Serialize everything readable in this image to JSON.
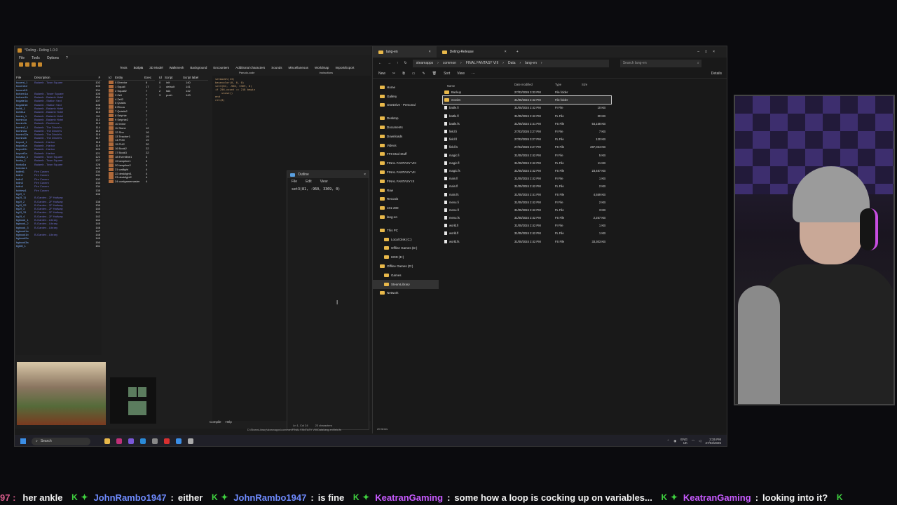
{
  "deling": {
    "title": "*Deling - Deling 1.0.0",
    "menu": [
      "File",
      "Tools",
      "Options",
      "?"
    ],
    "tabs": [
      "Texts",
      "Scripts",
      "3D Model",
      "Walkmesh",
      "Background",
      "Encounters",
      "Additional characters",
      "Sounds",
      "Miscellaneous",
      "Worldmap",
      "Import/Export"
    ],
    "field_list_headers": [
      "File",
      "Description",
      "#"
    ],
    "fields": [
      {
        "name": "bccent_1",
        "desc": "Balamb - Town Square",
        "id": "102"
      },
      {
        "name": "bccent12",
        "desc": "",
        "id": "103"
      },
      {
        "name": "bccent15",
        "desc": "",
        "id": "104"
      },
      {
        "name": "bcform1a",
        "desc": "Balamb - Tower Square",
        "id": "105"
      },
      {
        "name": "bcform1b",
        "desc": "Balamb - Balamb Hotel",
        "id": "106"
      },
      {
        "name": "bcgate1a",
        "desc": "Balamb - Station Yard",
        "id": "107"
      },
      {
        "name": "bcgate1b",
        "desc": "Balamb - Station Yard",
        "id": "108"
      },
      {
        "name": "bchtl_1",
        "desc": "Balamb - Balamb Hotel",
        "id": "109"
      },
      {
        "name": "bchtl1a",
        "desc": "Balamb - Balamb Hotel",
        "id": "110"
      },
      {
        "name": "bcmin_1",
        "desc": "Balamb - Balamb Hotel",
        "id": "111"
      },
      {
        "name": "bcmin1a",
        "desc": "Balamb - Balamb Hotel",
        "id": "112"
      },
      {
        "name": "bcmin1b",
        "desc": "Balamb - Residence",
        "id": "113"
      },
      {
        "name": "bcmin2_1",
        "desc": "Balamb - The Dincht's",
        "id": "114"
      },
      {
        "name": "bcmin2a",
        "desc": "Balamb - The Dincht's",
        "id": "115"
      },
      {
        "name": "bcmin22a",
        "desc": "Balamb - The Dincht's",
        "id": "116"
      },
      {
        "name": "bcmin2b",
        "desc": "Balamb - The Dincht's",
        "id": "117"
      },
      {
        "name": "bcport_1",
        "desc": "Balamb - Harbor",
        "id": "118"
      },
      {
        "name": "bcport1a",
        "desc": "Balamb - Harbor",
        "id": "119"
      },
      {
        "name": "bcport1b",
        "desc": "Balamb - Harbor",
        "id": "120"
      },
      {
        "name": "bcport2a",
        "desc": "Balamb - Harbor",
        "id": "121"
      },
      {
        "name": "bcsaka_1",
        "desc": "Balamb - Town Square",
        "id": "122"
      },
      {
        "name": "bcsta_1",
        "desc": "Balamb - Town Square",
        "id": "127"
      },
      {
        "name": "bcsta1a",
        "desc": "Balamb - Town Square",
        "id": "128"
      },
      {
        "name": "bdenter1",
        "desc": "",
        "id": "129"
      },
      {
        "name": "bdifrit1",
        "desc": "Fire Cavern",
        "id": "130"
      },
      {
        "name": "bdin1",
        "desc": "Fire Cavern",
        "id": "131"
      },
      {
        "name": "bdin2",
        "desc": "Fire Cavern",
        "id": "132"
      },
      {
        "name": "bdin3",
        "desc": "Fire Cavern",
        "id": "133"
      },
      {
        "name": "bdin4",
        "desc": "Fire Cavern",
        "id": "134"
      },
      {
        "name": "bdview1",
        "desc": "Fire Cavern",
        "id": "135"
      },
      {
        "name": "bg2f_1",
        "desc": "",
        "id": "136"
      },
      {
        "name": "bg2f_11",
        "desc": "B-Garden - 2F Hallway",
        "id": "-"
      },
      {
        "name": "bg2f_2",
        "desc": "B-Garden - 2F Hallway",
        "id": "138"
      },
      {
        "name": "bg2f_22",
        "desc": "B-Garden - 2F Hallway",
        "id": "139"
      },
      {
        "name": "bg2f_3",
        "desc": "B-Garden - 2F Hallway",
        "id": "140"
      },
      {
        "name": "bg2f_31",
        "desc": "B-Garden - 2F Hallway",
        "id": "141"
      },
      {
        "name": "bg2f_4",
        "desc": "B-Garden - 2F Hallway",
        "id": "142"
      },
      {
        "name": "bgbook_1",
        "desc": "B-Garden - Library",
        "id": "144"
      },
      {
        "name": "bgbook_2",
        "desc": "B-Garden - Library",
        "id": "145"
      },
      {
        "name": "bgbook_3",
        "desc": "B-Garden - Library",
        "id": "146"
      },
      {
        "name": "bgbook1a",
        "desc": "",
        "id": "147"
      },
      {
        "name": "bgbook1b",
        "desc": "B-Garden - Library",
        "id": "148"
      },
      {
        "name": "bgbook2a",
        "desc": "",
        "id": "149"
      },
      {
        "name": "bgbook3a",
        "desc": "",
        "id": "150"
      },
      {
        "name": "bgbill_1",
        "desc": "",
        "id": "151"
      }
    ],
    "entity_headers": [
      "Id",
      "Entity",
      "Exec"
    ],
    "entities": [
      {
        "n": "0 Director",
        "c": "6"
      },
      {
        "n": "1 Squall",
        "c": "17"
      },
      {
        "n": "2 Squall2",
        "c": "7"
      },
      {
        "n": "3 Zell",
        "c": "7"
      },
      {
        "n": "4 Zell2",
        "c": "7"
      },
      {
        "n": "5 Quistis",
        "c": "7"
      },
      {
        "n": "6 Rinoa",
        "c": "7"
      },
      {
        "n": "7 Quistis2",
        "c": "7"
      },
      {
        "n": "8 Selphie",
        "c": "7"
      },
      {
        "n": "9 Selphie2",
        "c": "7"
      },
      {
        "n": "10 Irvine",
        "c": "7"
      },
      {
        "n": "11 Stone",
        "c": "12"
      },
      {
        "n": "12 Shu",
        "c": "16"
      },
      {
        "n": "13 Teacher1",
        "c": "19"
      },
      {
        "n": "14 Pt30",
        "c": "19"
      },
      {
        "n": "15 Pt42",
        "c": "20"
      },
      {
        "n": "16 Book2",
        "c": "22"
      },
      {
        "n": "17 Book3",
        "c": "22"
      },
      {
        "n": "18 Eventline1",
        "c": "3"
      },
      {
        "n": "19 lampline1",
        "c": "3"
      },
      {
        "n": "20 lampline2",
        "c": "3"
      },
      {
        "n": "21 wallight",
        "c": "4"
      },
      {
        "n": "22 deskIight1",
        "c": "4"
      },
      {
        "n": "23 deskIight2",
        "c": "4"
      },
      {
        "n": "24 cardgamemaster",
        "c": "4"
      }
    ],
    "script_headers": [
      "Id",
      "Script",
      "Script label"
    ],
    "scripts": [
      {
        "id": "0",
        "name": "init",
        "label": "140"
      },
      {
        "id": "1",
        "name": "default",
        "label": "141"
      },
      {
        "id": "2",
        "name": "talk",
        "label": "142"
      },
      {
        "id": "3",
        "name": "push",
        "label": "143"
      }
    ],
    "code_headers": [
      "Pseudo-code",
      "Instructions"
    ],
    "code_lines": [
      "setmodel(13)",
      "basecolor(0, 0, 0)",
      "set3(81, -960, 3369, 0)",
      "if 256_count == 218 begin",
      "    unuse()",
      "end",
      "ret(8)"
    ],
    "compile_label": "Compile",
    "help_label": "Help",
    "path_status": "D:\\SteamLibrary\\steamapps\\common\\FINAL FANTASY VIII\\Data\\lang-en\\field.fs"
  },
  "notepad": {
    "title": "Outline",
    "menu": [
      "File",
      "Edit",
      "View"
    ],
    "content": "set3(81, -960, 3369, 0)",
    "status_pos": "Ln 1, Col 24",
    "status_chars": "23 characters"
  },
  "explorer": {
    "tabs": [
      "lang-en",
      "Deling-Release"
    ],
    "breadcrumbs": [
      "steamapps",
      "common",
      "FINAL FANTASY VIII",
      "Data",
      "lang-en"
    ],
    "search_placeholder": "Search lang-en",
    "commands": [
      "New",
      "Sort",
      "View",
      "Details"
    ],
    "nav_items": [
      {
        "label": "Home",
        "type": "top"
      },
      {
        "label": "Gallery",
        "type": "top"
      },
      {
        "label": "OneDrive - Personal",
        "type": "top"
      },
      {
        "label": "",
        "type": "gap"
      },
      {
        "label": "Desktop",
        "type": "pin"
      },
      {
        "label": "Documents",
        "type": "pin"
      },
      {
        "label": "Downloads",
        "type": "pin"
      },
      {
        "label": "Videos",
        "type": "pin"
      },
      {
        "label": "FF8 Mod Stuff",
        "type": "pin"
      },
      {
        "label": "FINAL FANTASY VIII",
        "type": "pin"
      },
      {
        "label": "FINAL FANTASY VII",
        "type": "pin"
      },
      {
        "label": "FINAL FANTASY IX",
        "type": "pin"
      },
      {
        "label": "Raw",
        "type": "pin"
      },
      {
        "label": "Recoois",
        "type": "pin"
      },
      {
        "label": "101-200",
        "type": "pin"
      },
      {
        "label": "lang-en",
        "type": "pin"
      },
      {
        "label": "",
        "type": "gap"
      },
      {
        "label": "This PC",
        "type": "top"
      },
      {
        "label": "Local Disk (C:)",
        "type": "sub"
      },
      {
        "label": "Offline Games (D:)",
        "type": "sub"
      },
      {
        "label": "HDD (E:)",
        "type": "sub"
      },
      {
        "label": "Offline Games (D:)",
        "type": "top"
      },
      {
        "label": "Games",
        "type": "sub"
      },
      {
        "label": "SteamLibrary",
        "type": "sel"
      },
      {
        "label": "Network",
        "type": "top"
      }
    ],
    "file_headers": [
      "Name",
      "Date modified",
      "Type",
      "Size"
    ],
    "files": [
      {
        "name": "Backup",
        "date": "27/03/2026 3:33 PM",
        "type": "File folder",
        "size": "",
        "folder": true
      },
      {
        "name": "movies",
        "date": "31/05/2024 2:42 PM",
        "type": "File folder",
        "size": "",
        "folder": true,
        "sel": true
      },
      {
        "name": "battle.fi",
        "date": "31/05/2024 2:42 PM",
        "type": "FI File",
        "size": "10 KB"
      },
      {
        "name": "battle.fl",
        "date": "31/05/2024 2:42 PM",
        "type": "FL File",
        "size": "30 KB"
      },
      {
        "name": "battle.fs",
        "date": "31/05/2024 2:41 PM",
        "type": "FS File",
        "size": "54,158 KB"
      },
      {
        "name": "field.fi",
        "date": "27/03/2026 3:27 PM",
        "type": "FI File",
        "size": "7 KB"
      },
      {
        "name": "field.fl",
        "date": "27/03/2026 3:27 PM",
        "type": "FL File",
        "size": "120 KB"
      },
      {
        "name": "field.fs",
        "date": "27/03/2026 3:27 PM",
        "type": "FS File",
        "size": "287,034 KB"
      },
      {
        "name": "magic.fi",
        "date": "31/05/2024 2:42 PM",
        "type": "FI File",
        "size": "5 KB"
      },
      {
        "name": "magic.fl",
        "date": "31/05/2024 2:42 PM",
        "type": "FL File",
        "size": "11 KB"
      },
      {
        "name": "magic.fs",
        "date": "31/05/2024 2:42 PM",
        "type": "FS File",
        "size": "23,487 KB"
      },
      {
        "name": "main.fi",
        "date": "31/05/2024 2:42 PM",
        "type": "FI File",
        "size": "1 KB"
      },
      {
        "name": "main.fl",
        "date": "31/05/2024 2:42 PM",
        "type": "FL File",
        "size": "2 KB"
      },
      {
        "name": "main.fs",
        "date": "31/05/2024 2:41 PM",
        "type": "FS File",
        "size": "4,559 KB"
      },
      {
        "name": "menu.fi",
        "date": "31/05/2024 2:42 PM",
        "type": "FI File",
        "size": "2 KB"
      },
      {
        "name": "menu.fl",
        "date": "31/05/2024 2:42 PM",
        "type": "FL File",
        "size": "3 KB"
      },
      {
        "name": "menu.fs",
        "date": "31/05/2024 2:42 PM",
        "type": "FS File",
        "size": "2,257 KB"
      },
      {
        "name": "world.fi",
        "date": "31/05/2024 2:42 PM",
        "type": "FI File",
        "size": "1 KB"
      },
      {
        "name": "world.fl",
        "date": "31/05/2024 2:42 PM",
        "type": "FL File",
        "size": "1 KB"
      },
      {
        "name": "world.fs",
        "date": "31/05/2024 2:42 PM",
        "type": "FS File",
        "size": "33,303 KB"
      }
    ],
    "status": "20 items"
  },
  "taskbar": {
    "search_label": "Search",
    "lang": "ENG",
    "region": "UK",
    "time": "3:35 PM",
    "date": "27/03/2026"
  },
  "ticker": [
    {
      "user": "",
      "msg": "her ankle"
    },
    {
      "user": "JohnRambo1947",
      "msg": "either"
    },
    {
      "user": "JohnRambo1947",
      "msg": "is fine"
    },
    {
      "user": "KeatranGaming",
      "msg": "some how a loop is cocking up on variables..."
    },
    {
      "user": "KeatranGaming",
      "msg": "looking into it?"
    }
  ],
  "ticker_prefix": "97",
  "colors": {
    "accent": "#3b8ee6",
    "folder": "#e8b84a",
    "chat_user": "#6f8bff",
    "chat_user_alt": "#c85bff",
    "badge": "#3fd13f"
  }
}
